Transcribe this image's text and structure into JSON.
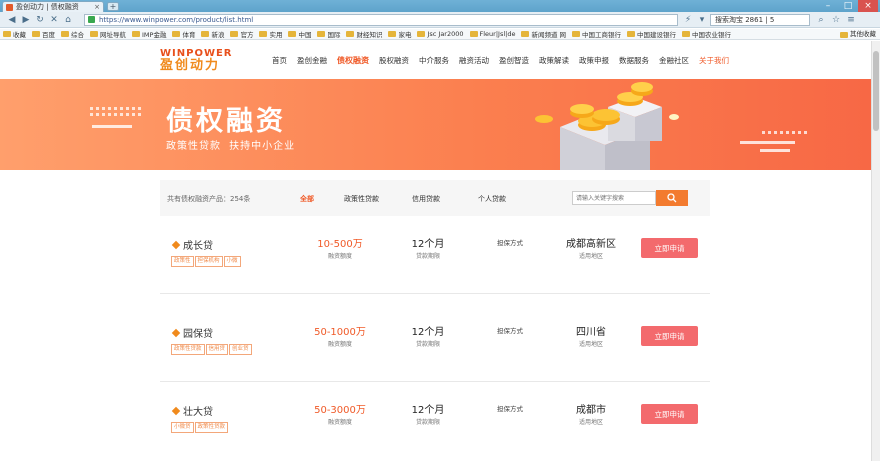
{
  "browser": {
    "tab_title": "盈创动力 | 债权融资",
    "url": "https://www.winpower.com/product/list.html",
    "search_text": "搜索淘宝 2861 | 5",
    "bookmarks": [
      "收藏",
      "百度",
      "综合",
      "网址导航",
      "IMP金融",
      "体育",
      "新浪",
      "官方",
      "实用",
      "中国",
      "国际",
      "财经知识",
      "家电",
      "Jsc Jar2000",
      "Fleur|Jsl|de",
      "新闻频道 网",
      "中国工商银行",
      "中国建设银行",
      "中国农业银行"
    ],
    "bookmarks_right": "其他收藏"
  },
  "site": {
    "logo_en": "WINPOWER",
    "logo_cn": "盈创动力",
    "nav": [
      "首页",
      "盈创金融",
      "债权融资",
      "股权融资",
      "中介服务",
      "融资活动",
      "盈创智造",
      "政策解读",
      "政策申报",
      "数据服务",
      "金融社区",
      "关于我们"
    ]
  },
  "banner": {
    "title": "债权融资",
    "subtitle": "政策性贷款 扶持中小企业"
  },
  "filter": {
    "count_text": "共有债权融资产品：254条",
    "tabs": [
      "全部",
      "政策性贷款",
      "信用贷款",
      "个人贷款"
    ],
    "search_placeholder": "请输入关键字搜索"
  },
  "method_label": "担保方式",
  "amount_caption": "融资额度",
  "term_caption": "贷款期限",
  "region_caption": "适用地区",
  "apply_label": "立即申请",
  "products": [
    {
      "name": "成长贷",
      "tags": [
        "政策性",
        "担保机构",
        "小微"
      ],
      "amount": "10-500万",
      "term": "12个月",
      "region": "成都高新区"
    },
    {
      "name": "园保贷",
      "tags": [
        "政策性贷款",
        "信用贷",
        "创业贷"
      ],
      "amount": "50-1000万",
      "term": "12个月",
      "region": "四川省"
    },
    {
      "name": "壮大贷",
      "tags": [
        "小微贷",
        "政策性贷款"
      ],
      "amount": "50-3000万",
      "term": "12个月",
      "region": "成都市"
    }
  ],
  "colors": {
    "brand": "#f05a28",
    "banner": "#fb7f4f",
    "apply": "#f36a6d"
  }
}
